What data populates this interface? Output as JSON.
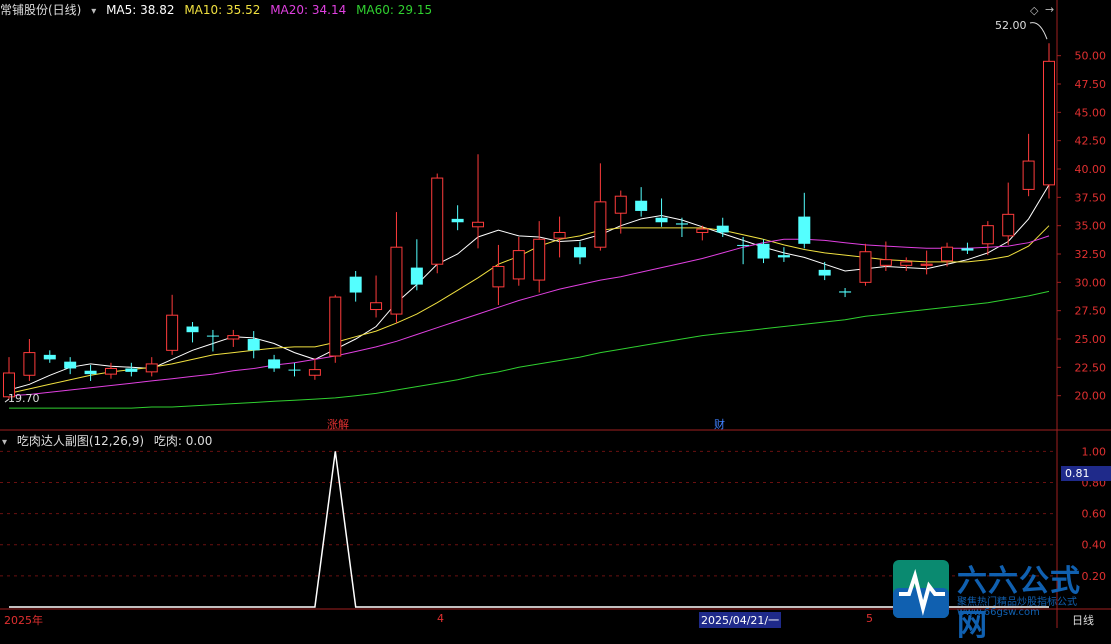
{
  "header": {
    "stock_title": "常铺股份(日线)",
    "ma5": "MA5: 38.82",
    "ma10": "MA10: 35.52",
    "ma20": "MA20: 34.14",
    "ma60": "MA60: 29.15",
    "colors": {
      "ma5": "#ffffff",
      "ma10": "#f0e040",
      "ma20": "#e040e0",
      "ma60": "#30d030"
    }
  },
  "sub_header": {
    "indicator": "吃肉达人副图(12,26,9)",
    "value": "吃肉: 0.00"
  },
  "markers": {
    "high": "52.00",
    "low": "19.70"
  },
  "event_tags": [
    {
      "label": "涨",
      "color": "#e03030"
    },
    {
      "label": "解",
      "color": "#e03030"
    },
    {
      "label": "财",
      "color": "#4080ff"
    }
  ],
  "sub_badge": "0.81",
  "x_labels": {
    "year": "2025年",
    "apr": "4",
    "date": "2025/04/21/一",
    "may": "5",
    "period": "日线"
  },
  "watermark": {
    "brand": "六六公式网",
    "slogan": "聚焦热门精品炒股指标公式",
    "url": "www.66gsw.com"
  },
  "chart_data": [
    {
      "type": "candlestick",
      "title": "常铺股份(日线)",
      "ylim": [
        17.5,
        53.5
      ],
      "y_ticks": [
        20.0,
        22.5,
        25.0,
        27.5,
        30.0,
        32.5,
        35.0,
        37.5,
        40.0,
        42.5,
        45.0,
        47.5,
        50.0
      ],
      "candles": [
        {
          "o": 19.9,
          "c": 22.0,
          "h": 23.4,
          "l": 19.7,
          "up": true
        },
        {
          "o": 21.8,
          "c": 23.8,
          "h": 25.0,
          "l": 21.3,
          "up": true
        },
        {
          "o": 23.6,
          "c": 23.2,
          "h": 24.0,
          "l": 22.9,
          "up": false
        },
        {
          "o": 23.0,
          "c": 22.4,
          "h": 23.4,
          "l": 21.9,
          "up": false
        },
        {
          "o": 22.2,
          "c": 21.9,
          "h": 22.7,
          "l": 21.3,
          "up": false
        },
        {
          "o": 21.9,
          "c": 22.4,
          "h": 22.9,
          "l": 21.5,
          "up": true
        },
        {
          "o": 22.4,
          "c": 22.1,
          "h": 22.9,
          "l": 21.7,
          "up": false
        },
        {
          "o": 22.1,
          "c": 22.8,
          "h": 23.4,
          "l": 21.7,
          "up": true
        },
        {
          "o": 24.0,
          "c": 27.1,
          "h": 28.9,
          "l": 23.6,
          "up": true
        },
        {
          "o": 26.1,
          "c": 25.6,
          "h": 26.5,
          "l": 24.7,
          "up": false
        },
        {
          "o": 25.3,
          "c": 25.3,
          "h": 25.8,
          "l": 23.9,
          "up": false
        },
        {
          "o": 25.0,
          "c": 25.3,
          "h": 25.8,
          "l": 24.3,
          "up": true
        },
        {
          "o": 25.0,
          "c": 24.0,
          "h": 25.7,
          "l": 23.3,
          "up": false
        },
        {
          "o": 23.2,
          "c": 22.4,
          "h": 23.6,
          "l": 22.1,
          "up": false
        },
        {
          "o": 22.3,
          "c": 22.3,
          "h": 22.9,
          "l": 21.7,
          "up": false
        },
        {
          "o": 21.8,
          "c": 22.3,
          "h": 23.3,
          "l": 21.4,
          "up": true
        },
        {
          "o": 23.5,
          "c": 28.7,
          "h": 28.9,
          "l": 22.9,
          "up": true
        },
        {
          "o": 30.5,
          "c": 29.1,
          "h": 31.0,
          "l": 28.3,
          "up": false
        },
        {
          "o": 27.6,
          "c": 28.2,
          "h": 30.6,
          "l": 26.9,
          "up": true
        },
        {
          "o": 27.2,
          "c": 33.1,
          "h": 36.2,
          "l": 26.4,
          "up": true
        },
        {
          "o": 31.3,
          "c": 29.8,
          "h": 33.8,
          "l": 29.3,
          "up": false
        },
        {
          "o": 31.6,
          "c": 39.2,
          "h": 39.6,
          "l": 30.8,
          "up": true
        },
        {
          "o": 35.6,
          "c": 35.3,
          "h": 36.8,
          "l": 34.6,
          "up": false
        },
        {
          "o": 35.3,
          "c": 34.9,
          "h": 41.3,
          "l": 33.0,
          "up": true
        },
        {
          "o": 29.6,
          "c": 31.4,
          "h": 33.3,
          "l": 28.0,
          "up": true
        },
        {
          "o": 30.3,
          "c": 32.8,
          "h": 34.0,
          "l": 29.7,
          "up": true
        },
        {
          "o": 30.2,
          "c": 33.8,
          "h": 35.4,
          "l": 29.1,
          "up": true
        },
        {
          "o": 33.9,
          "c": 34.4,
          "h": 35.8,
          "l": 32.2,
          "up": true
        },
        {
          "o": 33.1,
          "c": 32.2,
          "h": 33.6,
          "l": 31.6,
          "up": false
        },
        {
          "o": 33.1,
          "c": 37.1,
          "h": 40.5,
          "l": 32.8,
          "up": true
        },
        {
          "o": 36.1,
          "c": 37.6,
          "h": 38.1,
          "l": 34.3,
          "up": true
        },
        {
          "o": 37.2,
          "c": 36.3,
          "h": 38.4,
          "l": 35.8,
          "up": false
        },
        {
          "o": 35.7,
          "c": 35.3,
          "h": 37.4,
          "l": 34.9,
          "up": false
        },
        {
          "o": 35.2,
          "c": 35.1,
          "h": 35.7,
          "l": 34.0,
          "up": false
        },
        {
          "o": 34.7,
          "c": 34.4,
          "h": 35.0,
          "l": 33.7,
          "up": true
        },
        {
          "o": 35.0,
          "c": 34.4,
          "h": 35.7,
          "l": 34.0,
          "up": false
        },
        {
          "o": 33.3,
          "c": 33.3,
          "h": 34.0,
          "l": 31.6,
          "up": false
        },
        {
          "o": 33.4,
          "c": 32.1,
          "h": 33.8,
          "l": 31.7,
          "up": false
        },
        {
          "o": 32.4,
          "c": 32.2,
          "h": 33.1,
          "l": 31.8,
          "up": false
        },
        {
          "o": 35.8,
          "c": 33.4,
          "h": 37.9,
          "l": 33.0,
          "up": false
        },
        {
          "o": 31.1,
          "c": 30.6,
          "h": 31.8,
          "l": 30.2,
          "up": false
        },
        {
          "o": 29.2,
          "c": 29.1,
          "h": 29.5,
          "l": 28.7,
          "up": false
        },
        {
          "o": 30.0,
          "c": 32.7,
          "h": 33.4,
          "l": 29.7,
          "up": true
        },
        {
          "o": 31.5,
          "c": 32.0,
          "h": 33.6,
          "l": 31.0,
          "up": true
        },
        {
          "o": 31.5,
          "c": 31.8,
          "h": 32.2,
          "l": 31.0,
          "up": true
        },
        {
          "o": 31.5,
          "c": 31.6,
          "h": 32.8,
          "l": 30.7,
          "up": true
        },
        {
          "o": 31.9,
          "c": 33.1,
          "h": 33.5,
          "l": 31.4,
          "up": true
        },
        {
          "o": 33.0,
          "c": 32.8,
          "h": 33.5,
          "l": 32.5,
          "up": false
        },
        {
          "o": 33.4,
          "c": 35.0,
          "h": 35.4,
          "l": 32.4,
          "up": true
        },
        {
          "o": 34.1,
          "c": 36.0,
          "h": 38.8,
          "l": 33.3,
          "up": true
        },
        {
          "o": 38.2,
          "c": 40.7,
          "h": 43.1,
          "l": 37.6,
          "up": true
        },
        {
          "o": 38.6,
          "c": 49.5,
          "h": 51.1,
          "l": 37.4,
          "up": true
        }
      ],
      "series": [
        {
          "name": "MA5",
          "color": "#ffffff",
          "values": [
            20.5,
            21.0,
            21.8,
            22.5,
            22.8,
            22.6,
            22.5,
            22.4,
            23.2,
            24.0,
            24.6,
            25.2,
            25.1,
            24.6,
            23.8,
            23.2,
            24.1,
            25.0,
            26.1,
            28.2,
            29.8,
            31.6,
            32.5,
            34.0,
            34.6,
            34.1,
            34.0,
            33.6,
            33.7,
            34.2,
            35.0,
            35.6,
            35.9,
            35.5,
            34.9,
            34.3,
            33.7,
            33.1,
            32.6,
            32.2,
            31.6,
            31.0,
            31.2,
            31.4,
            31.3,
            31.2,
            31.6,
            32.0,
            32.6,
            33.6,
            35.6,
            38.6
          ]
        },
        {
          "name": "MA10",
          "color": "#f0e040",
          "values": [
            20.2,
            20.6,
            21.0,
            21.4,
            21.8,
            22.1,
            22.3,
            22.5,
            22.8,
            23.2,
            23.6,
            23.8,
            24.0,
            24.2,
            24.3,
            24.3,
            24.7,
            25.2,
            25.7,
            26.4,
            27.2,
            28.2,
            29.3,
            30.4,
            31.6,
            32.3,
            33.2,
            33.8,
            34.1,
            34.6,
            34.8,
            34.8,
            34.8,
            34.8,
            34.8,
            34.6,
            34.2,
            33.8,
            33.3,
            32.9,
            32.6,
            32.4,
            32.2,
            32.0,
            31.9,
            31.8,
            31.8,
            31.8,
            32.0,
            32.3,
            33.2,
            35.0
          ]
        },
        {
          "name": "MA20",
          "color": "#e040e0",
          "values": [
            20.0,
            20.1,
            20.3,
            20.5,
            20.7,
            20.9,
            21.1,
            21.3,
            21.5,
            21.7,
            21.9,
            22.2,
            22.4,
            22.7,
            22.9,
            23.2,
            23.5,
            23.9,
            24.3,
            24.8,
            25.4,
            26.0,
            26.6,
            27.2,
            27.8,
            28.4,
            28.9,
            29.4,
            29.8,
            30.2,
            30.5,
            30.9,
            31.3,
            31.7,
            32.1,
            32.6,
            33.1,
            33.5,
            33.8,
            33.8,
            33.7,
            33.5,
            33.3,
            33.2,
            33.1,
            33.0,
            33.0,
            33.0,
            33.1,
            33.2,
            33.5,
            34.1
          ]
        },
        {
          "name": "MA60",
          "color": "#30d030",
          "values": [
            18.9,
            18.9,
            18.9,
            18.9,
            18.9,
            18.9,
            18.9,
            19.0,
            19.0,
            19.1,
            19.2,
            19.3,
            19.4,
            19.5,
            19.6,
            19.7,
            19.8,
            20.0,
            20.2,
            20.5,
            20.8,
            21.1,
            21.4,
            21.8,
            22.1,
            22.5,
            22.8,
            23.1,
            23.4,
            23.8,
            24.1,
            24.4,
            24.7,
            25.0,
            25.3,
            25.5,
            25.7,
            25.9,
            26.1,
            26.3,
            26.5,
            26.7,
            27.0,
            27.2,
            27.4,
            27.6,
            27.8,
            28.0,
            28.2,
            28.5,
            28.8,
            29.2
          ]
        }
      ]
    },
    {
      "type": "line",
      "title": "吃肉达人副图(12,26,9)",
      "ylim": [
        0,
        1.06
      ],
      "y_ticks": [
        0.2,
        0.4,
        0.6,
        0.8,
        1.0
      ],
      "series": [
        {
          "name": "吃肉",
          "color": "#ffffff",
          "values": [
            0,
            0,
            0,
            0,
            0,
            0,
            0,
            0,
            0,
            0,
            0,
            0,
            0,
            0,
            0,
            0,
            1,
            0,
            0,
            0,
            0,
            0,
            0,
            0,
            0,
            0,
            0,
            0,
            0,
            0,
            0,
            0,
            0,
            0,
            0,
            0,
            0,
            0,
            0,
            0,
            0,
            0,
            0,
            0,
            0,
            0,
            0,
            0,
            0,
            0,
            0,
            0
          ]
        }
      ]
    }
  ]
}
